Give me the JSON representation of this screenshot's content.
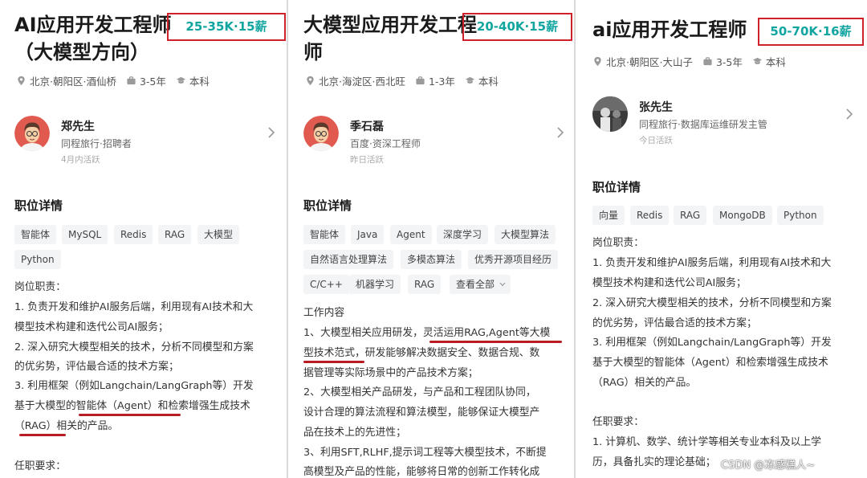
{
  "panel1": {
    "title": [
      "AI应用开发工程师",
      "（大模型方向）"
    ],
    "salary": "25-35K·15薪",
    "location": "北京·朝阳区·酒仙桥",
    "experience": "3-5年",
    "education": "本科",
    "recruiter": {
      "name": "郑先生",
      "org": "同程旅行·招聘者",
      "active": "4月内活跃"
    },
    "section": "职位详情",
    "tags": [
      "智能体",
      "MySQL",
      "Redis",
      "RAG",
      "大模型",
      "Python"
    ],
    "lines": [
      "岗位职责：",
      "1. 负责开发和维护AI服务后端，利用现有AI技术和大",
      "模型技术构建和迭代公司AI服务；",
      "2. 深入研究大模型相关的技术，分析不同模型和方案",
      "的优劣势，评估最合适的技术方案；",
      "3. 利用框架（例如Langchain/LangGraph等）开发",
      "基于大模型的智能体（Agent）和检索增强生成技术",
      "（RAG）相关的产品。",
      "",
      "任职要求："
    ]
  },
  "panel2": {
    "title": [
      "大模型应用开发工程",
      "师"
    ],
    "salary": "20-40K·15薪",
    "location": "北京·海淀区·西北旺",
    "experience": "1-3年",
    "education": "本科",
    "recruiter": {
      "name": "季石磊",
      "org": "百度·资深工程师",
      "active": "昨日活跃"
    },
    "section": "职位详情",
    "tags": [
      "智能体",
      "Java",
      "Agent",
      "深度学习",
      "大模型算法",
      "自然语言处理算法",
      "多模态算法",
      "优秀开源项目经历",
      "C/C++",
      "机器学习",
      "RAG",
      "查看全部"
    ],
    "lines": [
      "工作内容",
      "1、大模型相关应用研发，灵活运用RAG,Agent等大模",
      "型技术范式，研发能够解决数据安全、数据合规、数",
      "据管理等实际场景中的产品技术方案；",
      "2、大模型相关产品研发，与产品和工程团队协同，",
      "设计合理的算法流程和算法模型，能够保证大模型产",
      "品在技术上的先进性；",
      "3、利用SFT,RLHF,提示词工程等大模型技术，不断提",
      "高模型及产品的性能，能够将日常的创新工作转化成"
    ]
  },
  "panel3": {
    "title": [
      "ai应用开发工程师"
    ],
    "salary": "50-70K·16薪",
    "location": "北京·朝阳区·大山子",
    "experience": "3-5年",
    "education": "本科",
    "recruiter": {
      "name": "张先生",
      "org": "同程旅行·数据库运维研发主管",
      "active": "今日活跃"
    },
    "section": "职位详情",
    "tags": [
      "向量",
      "Redis",
      "RAG",
      "MongoDB",
      "Python"
    ],
    "lines": [
      "岗位职责：",
      "1. 负责开发和维护AI服务后端，利用现有AI技术和大",
      "模型技术构建和迭代公司AI服务；",
      "2. 深入研究大模型相关的技术，分析不同模型和方案",
      "的优劣势，评估最合适的技术方案；",
      "3. 利用框架（例如Langchain/LangGraph等）开发",
      "基于大模型的智能体（Agent）和检索增强生成技术",
      "（RAG）相关的产品。",
      "",
      "任职要求：",
      "1. 计算机、数学、统计学等相关专业本科及以上学",
      "历，具备扎实的理论基础；"
    ]
  },
  "watermark": "CSDN @冻感糕人~",
  "colors": {
    "salary": "#11a5a0",
    "highlight_box": "#d0212a",
    "underline": "#b81d24"
  }
}
